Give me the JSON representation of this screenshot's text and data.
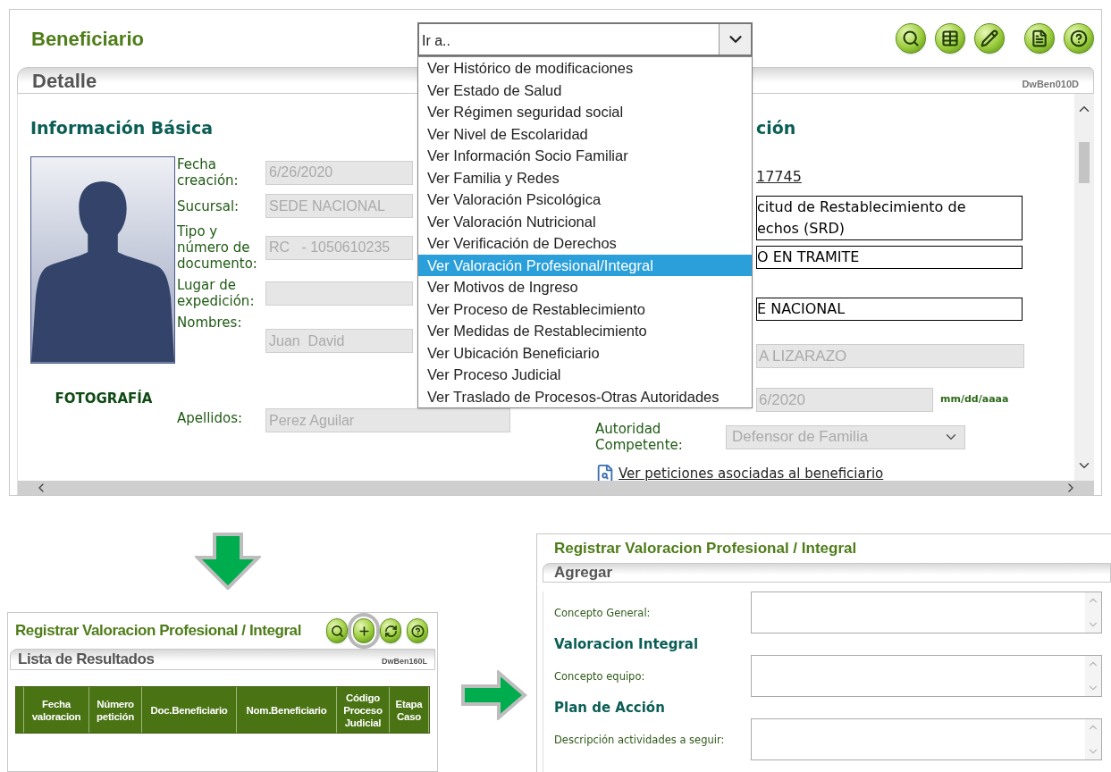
{
  "main": {
    "title": "Beneficiario",
    "toolbar": [
      {
        "kind": "search"
      },
      {
        "kind": "table"
      },
      {
        "kind": "edit"
      },
      {
        "kind": "document"
      },
      {
        "kind": "help"
      }
    ],
    "goto": {
      "value": "Ir a..",
      "options": [
        {
          "label": "Ver Histórico de modificaciones",
          "selected": false
        },
        {
          "label": "Ver Estado de Salud",
          "selected": false
        },
        {
          "label": "Ver Régimen seguridad social",
          "selected": false
        },
        {
          "label": "Ver Nivel de Escolaridad",
          "selected": false
        },
        {
          "label": "Ver Información Socio Familiar",
          "selected": false
        },
        {
          "label": "Ver Familia y Redes",
          "selected": false
        },
        {
          "label": "Ver Valoración Psicológica",
          "selected": false
        },
        {
          "label": "Ver Valoración Nutricional",
          "selected": false
        },
        {
          "label": "Ver Verificación de Derechos",
          "selected": false
        },
        {
          "label": "Ver Valoración Profesional/Integral",
          "selected": true
        },
        {
          "label": "Ver Motivos de Ingreso",
          "selected": false
        },
        {
          "label": "Ver Proceso de Restablecimiento",
          "selected": false
        },
        {
          "label": "Ver Medidas de Restablecimiento",
          "selected": false
        },
        {
          "label": "Ver Ubicación Beneficiario",
          "selected": false
        },
        {
          "label": "Ver Proceso Judicial",
          "selected": false
        },
        {
          "label": "Ver Traslado de Procesos-Otras Autoridades",
          "selected": false
        }
      ]
    },
    "detail": {
      "title": "Detalle",
      "code": "DwBen010D",
      "left": {
        "heading": "Información Básica",
        "photo_caption": "FOTOGRAFÍA",
        "fields": [
          {
            "label": "Fecha creación:",
            "value": "6/26/2020"
          },
          {
            "label": "Sucursal:",
            "value": "SEDE NACIONAL"
          },
          {
            "label": "Tipo y número de documento:",
            "value": "RC   - 1050610235"
          },
          {
            "label": "Lugar de expedición:"
          },
          {
            "label": "Nombres:",
            "value": "Juan  David"
          }
        ],
        "surname": {
          "label": "Apellidos:",
          "value": "Perez Aguilar"
        }
      },
      "right": {
        "heading": "ción",
        "items": [
          {
            "kind": "link",
            "lines": [
              "17745"
            ]
          },
          {
            "kind": "field",
            "lines": [
              "citud de Restablecimiento de",
              "echos (SRD)"
            ]
          },
          {
            "kind": "field",
            "lines": [
              "O EN TRAMITE"
            ]
          },
          {
            "kind": "field",
            "lines": [
              "E NACIONAL"
            ]
          },
          {
            "kind": "readonly",
            "lines": [
              "A LIZARAZO"
            ]
          },
          {
            "kind": "date",
            "lines": [
              "6/2020"
            ],
            "hint": "mm/dd/aaaa"
          }
        ],
        "authority": {
          "label": "Autoridad Competente:",
          "value": "Defensor de Familia"
        },
        "petitions_link": "Ver peticiones asociadas al beneficiario"
      }
    }
  },
  "list_panel": {
    "title": "Registrar Valoracion Profesional / Integral",
    "toolbar": [
      {
        "kind": "search",
        "highlighted": false
      },
      {
        "kind": "add",
        "highlighted": true
      },
      {
        "kind": "refresh",
        "highlighted": false
      },
      {
        "kind": "help",
        "highlighted": false
      }
    ],
    "subtitle": "Lista de Resultados",
    "code": "DwBen160L",
    "columns": [
      "Fecha valoracion",
      "Número petición",
      "Doc.Beneficiario",
      "Nom.Beneficiario",
      "Código Proceso Judicial",
      "Etapa Caso"
    ]
  },
  "form_panel": {
    "title": "Registrar Valoracion Profesional / Integral",
    "subtitle": "Agregar",
    "rows": [
      {
        "kind": "textarea",
        "label": "Concepto General:"
      },
      {
        "kind": "heading",
        "label": "Valoracion Integral"
      },
      {
        "kind": "textarea",
        "label": "Concepto equipo:"
      },
      {
        "kind": "heading",
        "label": "Plan de Acción"
      },
      {
        "kind": "textarea",
        "label": "Descripción actividades a seguir:"
      }
    ]
  }
}
